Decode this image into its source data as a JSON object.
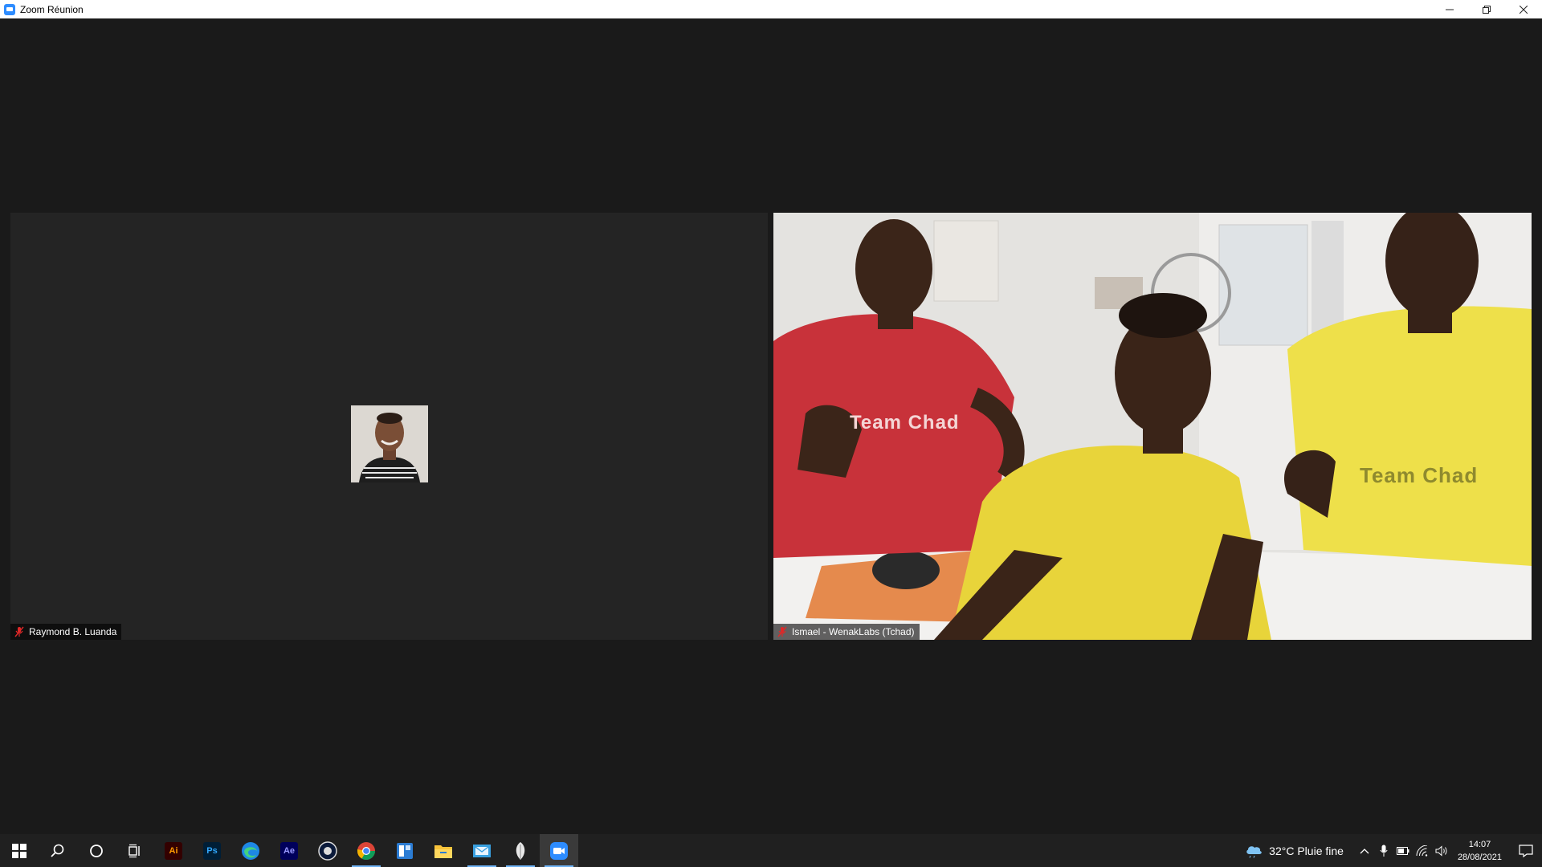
{
  "window": {
    "title": "Zoom Réunion",
    "minimize_label": "–",
    "restore_label": "❐",
    "close_label": "✕"
  },
  "participants": [
    {
      "name": "Raymond B. Luanda",
      "video_on": false,
      "muted": true
    },
    {
      "name": "Ismael - WenakLabs (Tchad)",
      "video_on": true,
      "muted": true
    }
  ],
  "video_overlay": {
    "shirt_text_1": "Team Chad",
    "shirt_text_2": "Team Chad"
  },
  "taskbar": {
    "apps": [
      {
        "name": "start",
        "icon": "windows-icon"
      },
      {
        "name": "search",
        "icon": "search-icon"
      },
      {
        "name": "cortana",
        "icon": "cortana-icon"
      },
      {
        "name": "task-view",
        "icon": "task-view-icon"
      },
      {
        "name": "illustrator",
        "icon": "illustrator-icon",
        "label": "Ai"
      },
      {
        "name": "photoshop",
        "icon": "photoshop-icon",
        "label": "Ps"
      },
      {
        "name": "edge",
        "icon": "edge-icon"
      },
      {
        "name": "after-effects",
        "icon": "after-effects-icon",
        "label": "Ae"
      },
      {
        "name": "cinema4d",
        "icon": "cinema4d-icon"
      },
      {
        "name": "chrome",
        "icon": "chrome-icon"
      },
      {
        "name": "app-blue",
        "icon": "app-window-icon"
      },
      {
        "name": "file-explorer",
        "icon": "folder-icon"
      },
      {
        "name": "mail",
        "icon": "mail-icon"
      },
      {
        "name": "feather-app",
        "icon": "feather-icon"
      },
      {
        "name": "zoom",
        "icon": "zoom-icon"
      }
    ],
    "weather": "32°C  Pluie fine",
    "time": "14:07",
    "date": "28/08/2021"
  },
  "colors": {
    "zoom_blue": "#2d8cff",
    "meeting_bg": "#1a1a1a",
    "tile_bg": "#242424",
    "taskbar_bg": "#202020",
    "muted_red": "#e02828"
  }
}
